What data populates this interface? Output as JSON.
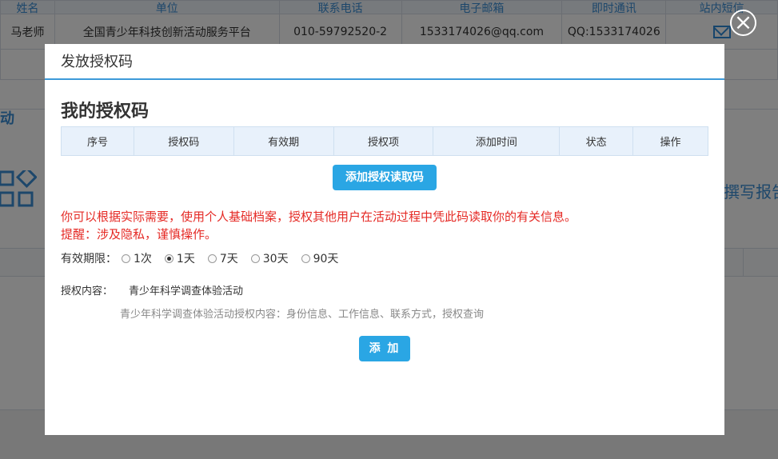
{
  "background": {
    "table_headers": [
      "姓名",
      "单位",
      "联系电话",
      "电子邮箱",
      "即时通讯",
      "站内短信"
    ],
    "row": {
      "name": "马老师",
      "org": "全国青少年科技创新活动服务平台",
      "phone": "010-59792520-2",
      "email": "1533174026@qq.com",
      "im": "QQ:1533174026"
    },
    "side_text": "动",
    "right_text": "撰写报告"
  },
  "close_label": "×",
  "modal": {
    "title": "发放授权码",
    "section_title": "我的授权码",
    "table_headers": [
      "序号",
      "授权码",
      "有效期",
      "授权项",
      "添加时间",
      "状态",
      "操作"
    ],
    "add_code_button": "添加授权读取码",
    "warning_line1": "你可以根据实际需要，使用个人基础档案，授权其他用户在活动过程中凭此码读取你的有关信息。",
    "warning_line2": "提醒：涉及隐私，谨慎操作。",
    "validity_label": "有效期限：",
    "validity_options": [
      "1次",
      "1天",
      "7天",
      "30天",
      "90天"
    ],
    "validity_selected": "1天",
    "content_label": "授权内容：",
    "content_value": "青少年科学调查体验活动",
    "content_desc": "青少年科学调查体验活动授权内容：身份信息、工作信息、联系方式，授权查询",
    "add_button": "添 加"
  },
  "colors": {
    "accent": "#2aa6e4",
    "header_line": "#3d9ad9",
    "warning": "#e52a25",
    "table_header_bg": "#e8f1fb"
  }
}
